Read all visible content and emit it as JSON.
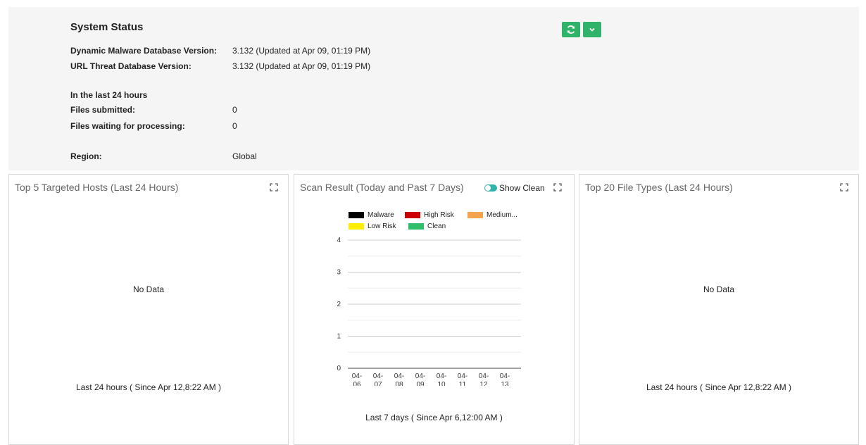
{
  "system_status": {
    "title": "System Status",
    "malware_db_label": "Dynamic Malware Database Version:",
    "malware_db_value": "3.132 (Updated at Apr 09, 01:19 PM)",
    "url_db_label": "URL Threat Database Version:",
    "url_db_value": "3.132 (Updated at Apr 09, 01:19 PM)",
    "period_heading": "In the last 24 hours",
    "files_submitted_label": "Files submitted:",
    "files_submitted_value": "0",
    "files_waiting_label": "Files waiting for processing:",
    "files_waiting_value": "0",
    "region_label": "Region:",
    "region_value": "Global",
    "refresh_icon": "refresh-icon",
    "dropdown_icon": "chevron-down-icon",
    "button_color": "#2fb36b"
  },
  "cards": {
    "hosts": {
      "title": "Top 5 Targeted Hosts (Last 24 Hours)",
      "empty": "No Data",
      "footer": "Last 24 hours ( Since Apr 12,8:22 AM )"
    },
    "scan": {
      "title": "Scan Result (Today and Past 7 Days)",
      "toggle_label": "Show Clean",
      "toggle_on": true,
      "footer": "Last 7 days ( Since Apr 6,12:00 AM )"
    },
    "filetypes": {
      "title": "Top 20 File Types (Last 24 Hours)",
      "empty": "No Data",
      "footer": "Last 24 hours ( Since Apr 12,8:22 AM )"
    }
  },
  "chart_data": {
    "type": "bar",
    "categories": [
      "04-06",
      "04-07",
      "04-08",
      "04-09",
      "04-10",
      "04-11",
      "04-12",
      "04-13"
    ],
    "series": [
      {
        "name": "Malware",
        "color": "#000000",
        "values": [
          0,
          0,
          0,
          0,
          0,
          0,
          0,
          0
        ]
      },
      {
        "name": "High Risk",
        "color": "#cc0000",
        "values": [
          0,
          0,
          0,
          0,
          0,
          0,
          0,
          0
        ]
      },
      {
        "name": "Medium...",
        "color": "#f4a44f",
        "values": [
          0,
          0,
          0,
          0,
          0,
          0,
          0,
          0
        ]
      },
      {
        "name": "Low Risk",
        "color": "#ffee00",
        "values": [
          0,
          0,
          0,
          0,
          0,
          0,
          0,
          0
        ]
      },
      {
        "name": "Clean",
        "color": "#2fbf6a",
        "values": [
          0,
          0,
          0,
          0,
          0,
          0,
          0,
          0
        ]
      }
    ],
    "yticks": [
      0,
      1,
      2,
      3,
      4
    ],
    "ylim": [
      0,
      4
    ],
    "x_tick_labels": [
      [
        "04-",
        "06"
      ],
      [
        "04-",
        "07"
      ],
      [
        "04-",
        "08"
      ],
      [
        "04-",
        "09"
      ],
      [
        "04-",
        "10"
      ],
      [
        "04-",
        "11"
      ],
      [
        "04-",
        "12"
      ],
      [
        "04-",
        "13"
      ]
    ],
    "legend_position": "top",
    "grid": true
  }
}
